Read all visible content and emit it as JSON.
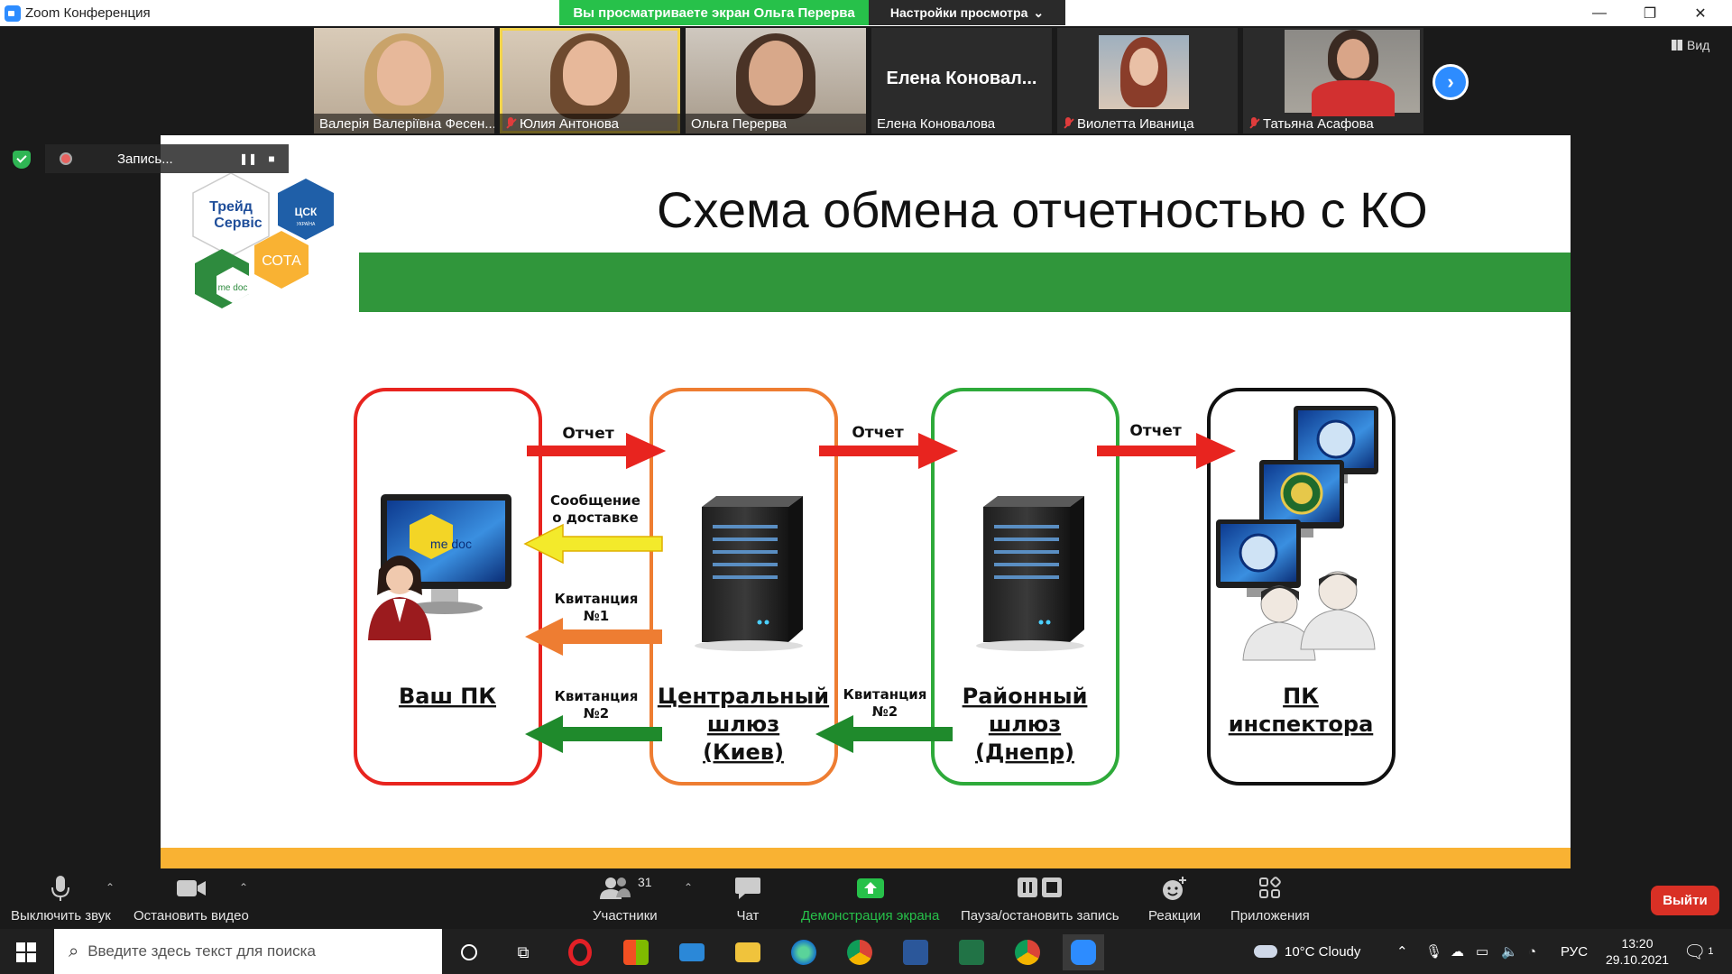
{
  "window": {
    "title": "Zoom Конференция"
  },
  "banner": {
    "sharing_text": "Вы просматриваете экран Ольга Перерва",
    "view_settings": "Настройки просмотра"
  },
  "participants": [
    {
      "name": "Валерія Валеріївна Фесен...",
      "muted": false
    },
    {
      "name": "Юлия Антонова",
      "muted": true
    },
    {
      "name": "Ольга Перерва",
      "muted": false
    },
    {
      "name": "Елена Коновалова",
      "big_name": "Елена  Коновал...",
      "muted": false
    },
    {
      "name": "Виолетта Иваница",
      "muted": true
    },
    {
      "name": "Татьяна Асафова",
      "muted": true
    }
  ],
  "view_button": "Вид",
  "recording": {
    "label": "Запись..."
  },
  "slide": {
    "title": "Схема обмена отчетностью с КО",
    "logos": {
      "trade": "Трейд",
      "service": "Сервіс",
      "csk": "ЦСК",
      "csk_sub": "УКРАЇНА",
      "sota": "СОТА",
      "medoc": "me doc"
    },
    "nodes": {
      "pc": "Ваш ПК",
      "central_1": "Центральный",
      "central_2": "шлюз",
      "central_3": "(Киев)",
      "district_1": "Районный",
      "district_2": "шлюз",
      "district_3": "(Днепр)",
      "inspector_1": "ПК",
      "inspector_2": "инспектора"
    },
    "monitor_label": "me doc",
    "arrows": {
      "report": "Отчет",
      "delivery_1": "Сообщение",
      "delivery_2": "о доставке",
      "receipt": "Квитанция",
      "no1": "№1",
      "no2": "№2"
    }
  },
  "toolbar": {
    "mute": "Выключить звук",
    "video": "Остановить видео",
    "participants": "Участники",
    "participants_count": "31",
    "chat": "Чат",
    "share": "Демонстрация экрана",
    "pause_record": "Пауза/остановить запись",
    "reactions": "Реакции",
    "apps": "Приложения",
    "leave": "Выйти"
  },
  "taskbar": {
    "search_placeholder": "Введите здесь текст для поиска",
    "weather": "10°C  Cloudy",
    "lang": "РУС",
    "time": "13:20",
    "date": "29.10.2021",
    "notif_count": "1"
  },
  "colors": {
    "zoom_blue": "#2d8cff",
    "share_green": "#27c14a",
    "slide_green": "#30963b",
    "slide_orange": "#f9b233",
    "leave_red": "#d93025"
  }
}
